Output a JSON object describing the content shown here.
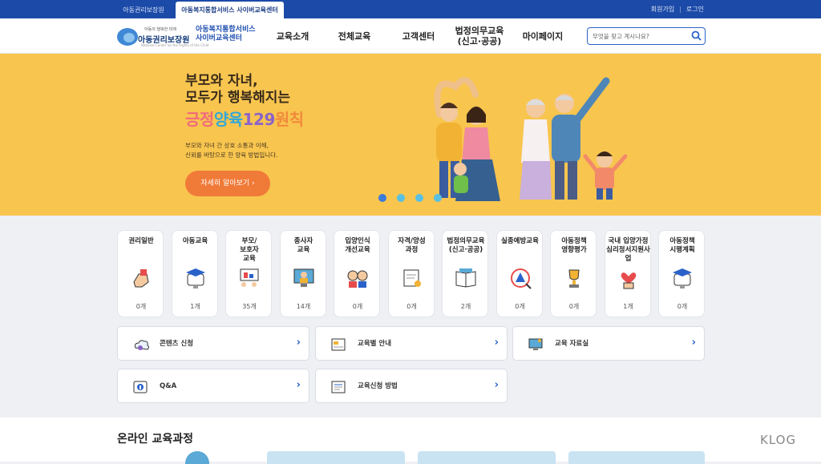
{
  "top_tabs": [
    "아동권리보장원",
    "아동복지통합서비스 사이버교육센터"
  ],
  "top_links": {
    "signup": "회원가입",
    "separator": "|",
    "login": "로그인"
  },
  "logo": {
    "sub": "아동의 행복한 미래",
    "main": "아동권리보장원",
    "tiny": "National Center for the Rights of the Child"
  },
  "service_name": [
    "아동복지통합서비스",
    "사이버교육센터"
  ],
  "nav": [
    "교육소개",
    "전체교육",
    "고객센터",
    [
      "법정의무교육",
      "(신고·공공)"
    ],
    "마이페이지"
  ],
  "search": {
    "placeholder": "무엇을 찾고 계시나요?"
  },
  "hero": {
    "line1": "부모와 자녀,",
    "line2": "모두가 행복해지는",
    "headline_parts": [
      "긍정",
      "양육",
      "129",
      "원칙"
    ],
    "desc": [
      "부모와 자녀 간 상호 소통과 이해,",
      "신뢰를 바탕으로 한 양육 방법입니다."
    ],
    "button": "자세히 알아보기",
    "slides": 4,
    "active_slide": 1
  },
  "categories": [
    {
      "label": [
        "권리일반"
      ],
      "count": "0개",
      "icon": "hand-icon"
    },
    {
      "label": [
        "아동교육"
      ],
      "count": "1개",
      "icon": "graduation-cap-icon"
    },
    {
      "label": [
        "부모/",
        "보호자",
        "교육"
      ],
      "count": "35개",
      "icon": "family-board-icon"
    },
    {
      "label": [
        "종사자",
        "교육"
      ],
      "count": "14개",
      "icon": "teacher-screen-icon"
    },
    {
      "label": [
        "입양인식",
        "개선교육"
      ],
      "count": "0개",
      "icon": "children-icon"
    },
    {
      "label": [
        "자격/양성",
        "과정"
      ],
      "count": "0개",
      "icon": "certificate-icon"
    },
    {
      "label": [
        "법정의무교육",
        "(신고·공공)"
      ],
      "count": "2개",
      "icon": "book-icon"
    },
    {
      "label": [
        "실종예방교육"
      ],
      "count": "0개",
      "icon": "warning-search-icon"
    },
    {
      "label": [
        "아동정책",
        "영향평가"
      ],
      "count": "0개",
      "icon": "trophy-icon"
    },
    {
      "label": [
        "국내 입양가정",
        "심리정서지원사업"
      ],
      "count": "1개",
      "icon": "heart-hand-icon"
    },
    {
      "label": [
        "아동정책",
        "시행계획"
      ],
      "count": "0개",
      "icon": "graduation-cap-icon"
    }
  ],
  "services": [
    {
      "label": "콘텐츠 신청",
      "icon": "cloud-icon"
    },
    {
      "label": "교육별 안내",
      "icon": "document-icon"
    },
    {
      "label": "교육 자료실",
      "icon": "monitor-icon"
    },
    {
      "label": "Q&A",
      "icon": "info-book-icon"
    },
    {
      "label": "교육신청 방법",
      "icon": "form-icon"
    }
  ],
  "section_title": "온라인 교육과정",
  "watermark": "KLOG",
  "colors": {
    "brand_blue": "#1b4aa8",
    "hero_bg": "#f8c54f",
    "button": "#f07a38"
  }
}
